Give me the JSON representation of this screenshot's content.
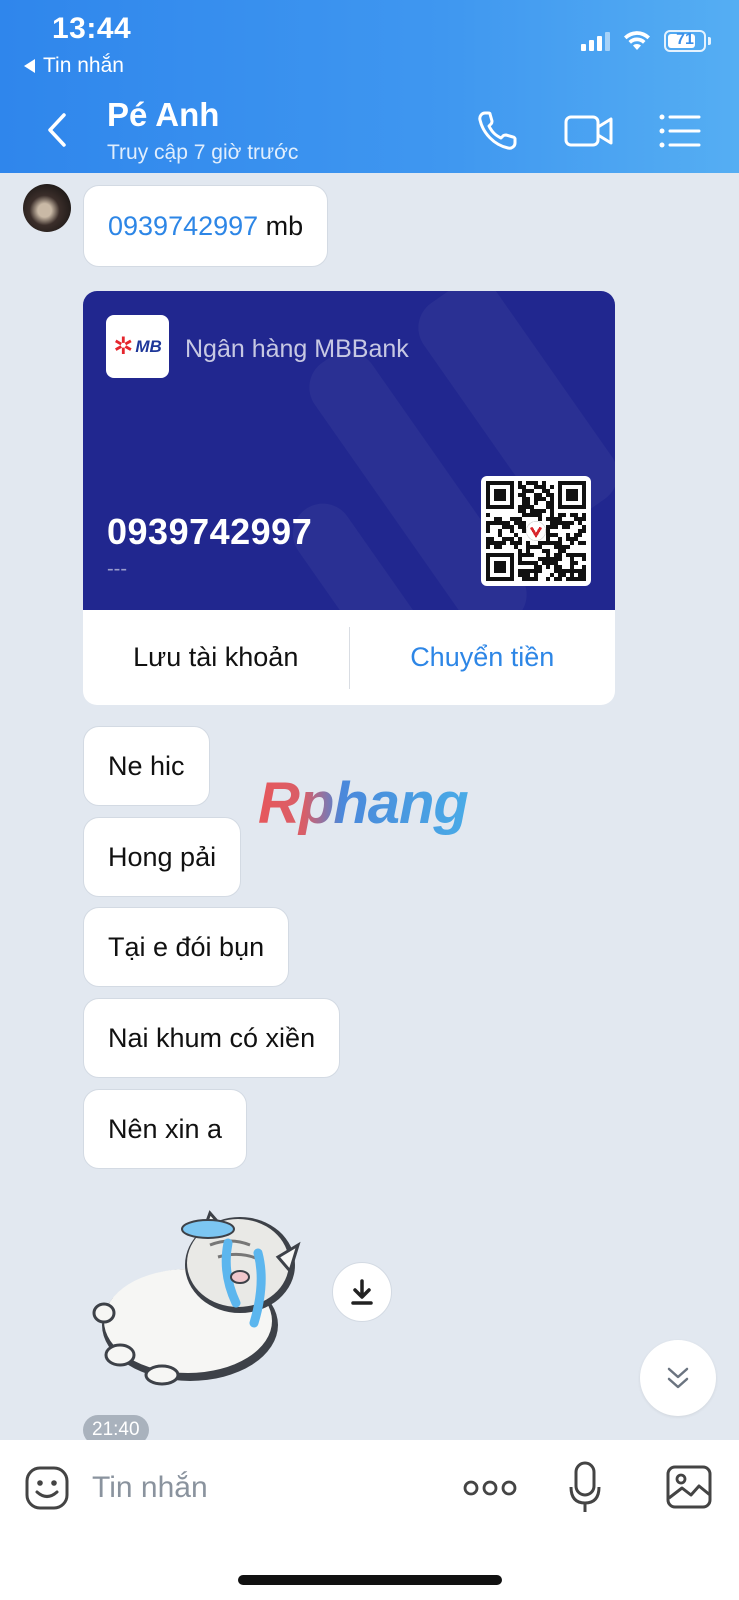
{
  "status_bar": {
    "time": "13:44",
    "back_app_label": "Tin nhắn",
    "battery_percent": "71"
  },
  "header": {
    "contact_name": "Pé Anh",
    "contact_status": "Truy cập 7 giờ trước",
    "icons": [
      "back-arrow-icon",
      "phone-icon",
      "video-camera-icon",
      "menu-list-icon"
    ]
  },
  "messages": {
    "first": {
      "phone": "0939742997",
      "suffix": " mb"
    },
    "bank_card": {
      "bank_name": "Ngân hàng MBBank",
      "logo_text": "MB",
      "account_number": "0939742997",
      "account_holder": "---",
      "save_label": "Lưu tài khoản",
      "transfer_label": "Chuyển tiền",
      "colors": {
        "card_bg": "#21278f",
        "accent": "#2d86e6"
      }
    },
    "texts": [
      "Ne hic",
      "Hong pải",
      "Tại e đói bụn",
      "Nai khum có xiền",
      "Nên xin a"
    ],
    "timestamp": "21:40"
  },
  "watermark": "Rphang",
  "input_bar": {
    "placeholder": "Tin nhắn",
    "icons": [
      "emoji-icon",
      "more-dots-icon",
      "microphone-icon",
      "image-icon"
    ]
  }
}
